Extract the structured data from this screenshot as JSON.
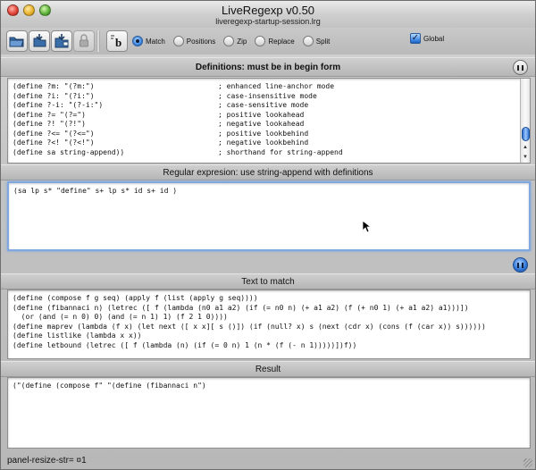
{
  "window": {
    "title": "LiveRegexp v0.50",
    "subtitle": "liveregexp-startup-session.lrg"
  },
  "toolbar": {
    "buttons": [
      {
        "name": "open-folder-icon"
      },
      {
        "name": "save-icon"
      },
      {
        "name": "save-as-icon"
      },
      {
        "name": "lock-icon"
      },
      {
        "name": "definitions-toggle-icon",
        "label": "b"
      }
    ],
    "modes": [
      {
        "label": "Match",
        "selected": true
      },
      {
        "label": "Positions",
        "selected": false
      },
      {
        "label": "Zip",
        "selected": false
      },
      {
        "label": "Replace",
        "selected": false
      },
      {
        "label": "Split",
        "selected": false
      }
    ],
    "global_label": "Global",
    "global_checked": true
  },
  "definitions": {
    "title": "Definitions: must be in begin form",
    "lines": [
      {
        "code": "(define ?m: \"(?m:\")",
        "comment": "; enhanced line-anchor mode"
      },
      {
        "code": "(define ?i: \"(?i:\")",
        "comment": "; case-insensitive mode"
      },
      {
        "code": "(define ?-i: \"(?-i:\")",
        "comment": "; case-sensitive mode"
      },
      {
        "code": "(define ?= \"(?=\")",
        "comment": "; positive lookahead"
      },
      {
        "code": "(define ?! \"(?!\")",
        "comment": "; negative lookahead"
      },
      {
        "code": "(define ?<= \"(?<=\")",
        "comment": "; positive lookbehind"
      },
      {
        "code": "(define ?<! \"(?<!\")",
        "comment": "; negative lookbehind"
      },
      {
        "code": "(define sa string-append))",
        "comment": "; shorthand for string-append"
      }
    ]
  },
  "regex": {
    "title": "Regular expresion: use string-append with definitions",
    "value": "(sa lp s* \"define\" s+ lp s* id s+ id )"
  },
  "text_to_match": {
    "title": "Text to match",
    "lines": [
      "(define (compose f g seq) (apply f (list (apply g seq))))",
      "(define (fibannaci n) (letrec ([ f (lambda (n0 a1 a2) (if (= n0 n) (+ a1 a2) (f (+ n0 1) (+ a1 a2) a1)))])",
      "  (or (and (= n 0) 0) (and (= n 1) 1) (f 2 1 0))))",
      "(define maprev (lambda (f x) (let next ([ x x][ s ()]) (if (null? x) s (next (cdr x) (cons (f (car x)) s))))))",
      "(define listlike (lambda x x))",
      "(define letbound (letrec ([ f (lambda (n) (if (= 0 n) 1 (n * (f (- n 1)))))])f))"
    ]
  },
  "result": {
    "title": "Result",
    "value": "(\"(define (compose f\" \"(define (fibannaci n\")"
  },
  "status": {
    "text": "panel-resize-str= ¤1"
  }
}
